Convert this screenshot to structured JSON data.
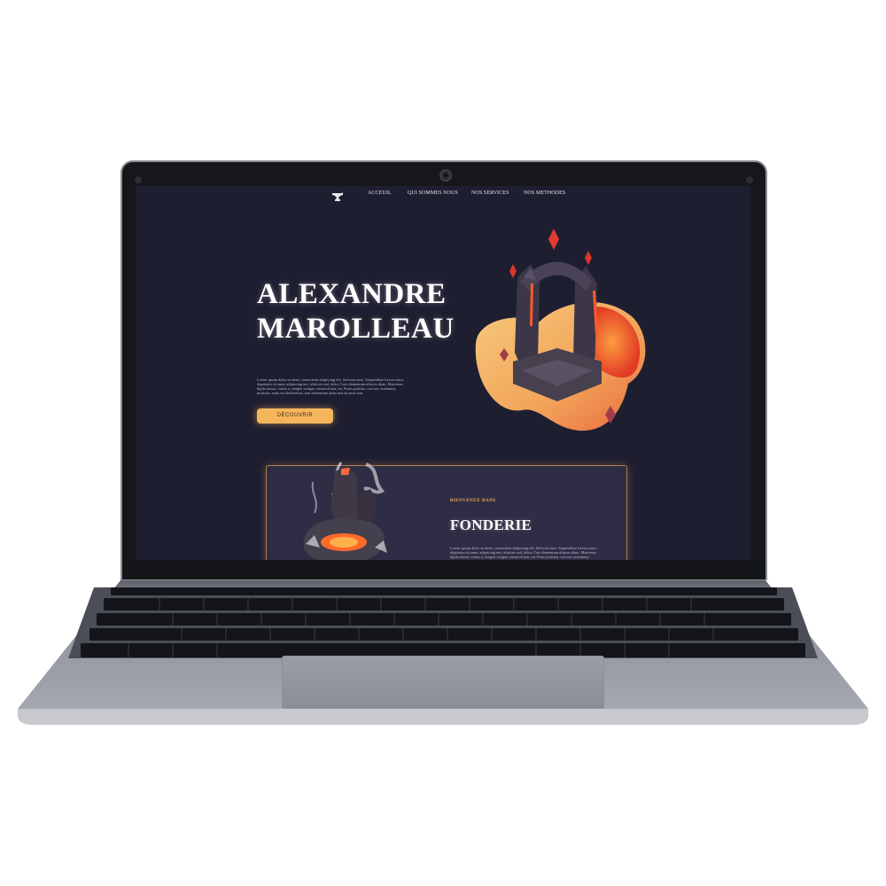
{
  "nav": {
    "items": [
      {
        "label": "ACCEUIL"
      },
      {
        "label": "QUI SOMMES NOUS"
      },
      {
        "label": "NOS SERVICES"
      },
      {
        "label": "NOS METHODES"
      }
    ],
    "logo_icon": "anvil-icon"
  },
  "hero": {
    "title_line1": "ALEXANDRE",
    "title_line2": "MAROLLEAU",
    "text": "Lorem ipsum dolor sit amet, consectetur adipiscing elit. Sed non risus. Suspendisse lectus tortor, dignissim sit amet, adipiscing nec, ultricies sed, dolor. Cras elementum ultrices diam. Maecenas ligula massa, varius a, semper congue, euismod non, mi. Proin porttitor, orci nec nonummy molestie, enim est eleifend mi, non fermentum diam nisl sit amet erat.",
    "button_label": "DÉCOUVRIR",
    "illustration_icon": "portal-icon"
  },
  "intro_card": {
    "kicker": "BIENVENUE DANS",
    "title": "FONDERIE",
    "text": "Lorem ipsum dolor sit amet, consectetur adipiscing elit. Sed non risus. Suspendisse lectus tortor, dignissim sit amet, adipiscing nec, ultricies sed, dolor. Cras elementum ultrices diam. Maecenas ligula massa, varius a, semper congue, euismod non, mi. Proin porttitor, orci nec nonummy molestie.",
    "illustration_icon": "forge-icon"
  },
  "colors": {
    "background": "#1e1e31",
    "accent": "#f5b55b",
    "card": "#2e2d45",
    "card_border": "#b07e44"
  }
}
